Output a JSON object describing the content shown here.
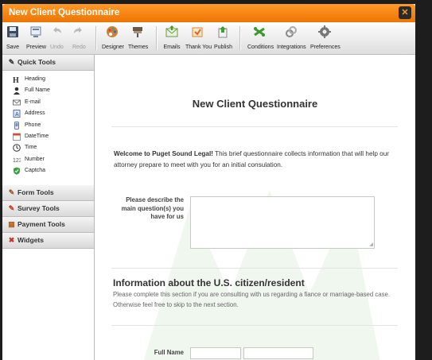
{
  "window": {
    "title": "New Client Questionnaire"
  },
  "toolbar": {
    "buttons": [
      {
        "label": "Save",
        "icon": "save-icon",
        "enabled": true
      },
      {
        "label": "Preview",
        "icon": "preview-icon",
        "enabled": true
      },
      {
        "label": "Undo",
        "icon": "undo-icon",
        "enabled": false
      },
      {
        "label": "Redo",
        "icon": "redo-icon",
        "enabled": false
      },
      {
        "label": "Designer",
        "icon": "designer-icon",
        "enabled": true
      },
      {
        "label": "Themes",
        "icon": "themes-icon",
        "enabled": true
      },
      {
        "label": "Emails",
        "icon": "emails-icon",
        "enabled": true
      },
      {
        "label": "Thank You",
        "icon": "thank-you-icon",
        "enabled": true
      },
      {
        "label": "Publish",
        "icon": "publish-icon",
        "enabled": true
      },
      {
        "label": "Conditions",
        "icon": "conditions-icon",
        "enabled": true
      },
      {
        "label": "Integrations",
        "icon": "integrations-icon",
        "enabled": true
      },
      {
        "label": "Preferences",
        "icon": "preferences-icon",
        "enabled": true
      }
    ]
  },
  "sidebar": {
    "quick_tools_label": "Quick Tools",
    "quick_tools": [
      {
        "label": "Heading",
        "icon": "heading-icon"
      },
      {
        "label": "Full Name",
        "icon": "person-icon"
      },
      {
        "label": "E-mail",
        "icon": "email-icon"
      },
      {
        "label": "Address",
        "icon": "address-icon"
      },
      {
        "label": "Phone",
        "icon": "phone-icon"
      },
      {
        "label": "DateTime",
        "icon": "calendar-icon"
      },
      {
        "label": "Time",
        "icon": "clock-icon"
      },
      {
        "label": "Number",
        "icon": "number-icon"
      },
      {
        "label": "Captcha",
        "icon": "captcha-shield-icon"
      }
    ],
    "sections": [
      {
        "label": "Form Tools",
        "icon": "form-tools-icon"
      },
      {
        "label": "Survey Tools",
        "icon": "survey-tools-icon"
      },
      {
        "label": "Payment Tools",
        "icon": "payment-tools-icon"
      },
      {
        "label": "Widgets",
        "icon": "widgets-icon"
      }
    ]
  },
  "form": {
    "title": "New Client Questionnaire",
    "intro_bold": "Welcome to Puget Sound Legal!",
    "intro_text": " This brief questionnaire collects information that will help our attorney prepare to meet with you for an initial consulation.",
    "question_label": "Please describe the main question(s) you have for us",
    "question_value": "",
    "section_title": "Information about the U.S. citizen/resident",
    "section_desc": "Please complete this section if you are consulting with us regarding a fiance or marriage-based case. Otherwise feel free to skip to the next section.",
    "full_name_label": "Full Name",
    "first_name_value": "",
    "last_name_value": ""
  },
  "colors": {
    "title_bar": "#ee7400",
    "accent": "#ff9a2a"
  }
}
